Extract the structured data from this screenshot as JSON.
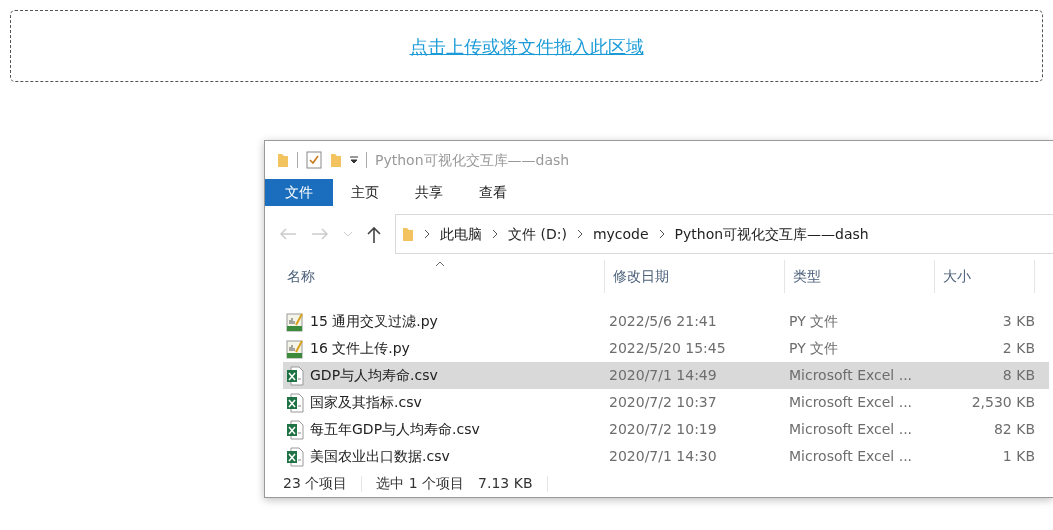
{
  "upload": {
    "text": "点击上传或将文件拖入此区域"
  },
  "explorer": {
    "title": "Python可视化交互库——dash",
    "ribbon_tabs": [
      {
        "label": "文件",
        "selected": true
      },
      {
        "label": "主页",
        "selected": false
      },
      {
        "label": "共享",
        "selected": false
      },
      {
        "label": "查看",
        "selected": false
      }
    ],
    "address": [
      "此电脑",
      "文件 (D:)",
      "mycode",
      "Python可视化交互库——dash"
    ],
    "columns": [
      {
        "label": "名称",
        "sorted": true
      },
      {
        "label": "修改日期",
        "sorted": false
      },
      {
        "label": "类型",
        "sorted": false
      },
      {
        "label": "大小",
        "sorted": false
      }
    ],
    "rows": [
      {
        "name": "15 通用交叉过滤.py",
        "kind": "py",
        "modified": "2022/5/6 21:41",
        "type": "PY 文件",
        "size": "3 KB",
        "selected": false
      },
      {
        "name": "16 文件上传.py",
        "kind": "py",
        "modified": "2022/5/20 15:45",
        "type": "PY 文件",
        "size": "2 KB",
        "selected": false
      },
      {
        "name": "GDP与人均寿命.csv",
        "kind": "csv",
        "modified": "2020/7/1 14:49",
        "type": "Microsoft Excel ...",
        "size": "8 KB",
        "selected": true
      },
      {
        "name": "国家及其指标.csv",
        "kind": "csv",
        "modified": "2020/7/2 10:37",
        "type": "Microsoft Excel ...",
        "size": "2,530 KB",
        "selected": false
      },
      {
        "name": "每五年GDP与人均寿命.csv",
        "kind": "csv",
        "modified": "2020/7/2 10:19",
        "type": "Microsoft Excel ...",
        "size": "82 KB",
        "selected": false
      },
      {
        "name": "美国农业出口数据.csv",
        "kind": "csv",
        "modified": "2020/7/1 14:30",
        "type": "Microsoft Excel ...",
        "size": "1 KB",
        "selected": false
      }
    ],
    "status": {
      "count": "23 个项目",
      "selection": "选中 1 个项目",
      "selection_size": "7.13 KB"
    }
  }
}
